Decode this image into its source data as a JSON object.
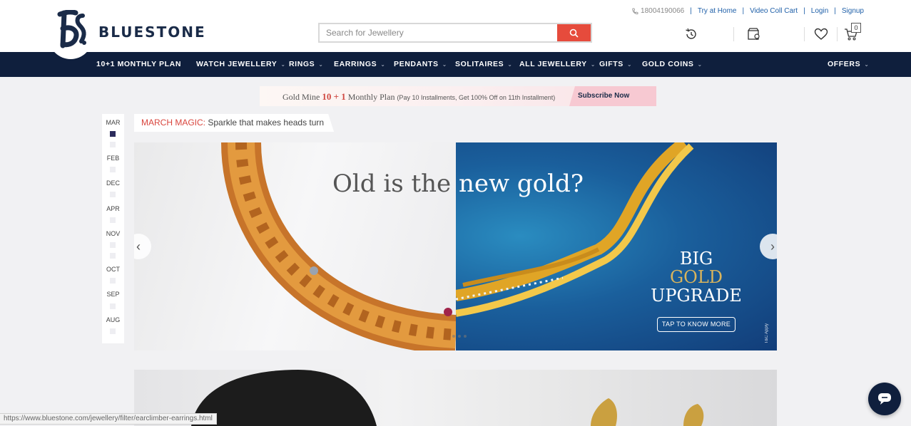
{
  "brand": {
    "name": "BLUESTONE"
  },
  "top_links": {
    "phone": "18004190066",
    "items": [
      "Try at Home",
      "Video Coll Cart",
      "Login",
      "Signup"
    ]
  },
  "search": {
    "placeholder": "Search for Jewellery"
  },
  "header_icons": [
    "history-icon",
    "store-locator-icon",
    "wishlist-heart-icon",
    "cart-icon"
  ],
  "cart": {
    "count": "0"
  },
  "nav": {
    "items": [
      {
        "label": "10+1 MONTHLY PLAN",
        "has_dropdown": false
      },
      {
        "label": "WATCH JEWELLERY",
        "has_dropdown": true
      },
      {
        "label": "RINGS",
        "has_dropdown": true
      },
      {
        "label": "EARRINGS",
        "has_dropdown": true
      },
      {
        "label": "PENDANTS",
        "has_dropdown": true
      },
      {
        "label": "SOLITAIRES",
        "has_dropdown": true
      },
      {
        "label": "ALL JEWELLERY",
        "has_dropdown": true
      },
      {
        "label": "GIFTS",
        "has_dropdown": true
      },
      {
        "label": "GOLD COINS",
        "has_dropdown": true
      }
    ],
    "offers": {
      "label": "OFFERS",
      "has_dropdown": true
    }
  },
  "promo": {
    "prefix": "Gold Mine",
    "highlight": "10 + 1",
    "suffix": "Monthly Plan",
    "detail": "(Pay 10 Installments, Get 100% Off on 11th Installment)",
    "cta": "Subscribe Now"
  },
  "months": {
    "active": "MAR",
    "items": [
      "MAR",
      "FEB",
      "DEC",
      "APR",
      "NOV",
      "OCT",
      "SEP",
      "AUG"
    ]
  },
  "campaign": {
    "title": "MARCH MAGIC:",
    "subtitle": "Sparkle that makes heads turn"
  },
  "banner": {
    "headline_part1": "Old is the",
    "headline_part2": "new gold?",
    "badge_lines": [
      "BIG",
      "GOLD",
      "UPGRADE"
    ],
    "cta": "TAP TO KNOW MORE",
    "tnc": "T&C Apply"
  },
  "status_url": "https://www.bluestone.com/jewellery/filter/earclimber-earrings.html",
  "colors": {
    "navy": "#0f1f3d",
    "accent_red": "#e64b3c",
    "link_blue": "#1e5fa8",
    "gold": "#d9b45c"
  }
}
